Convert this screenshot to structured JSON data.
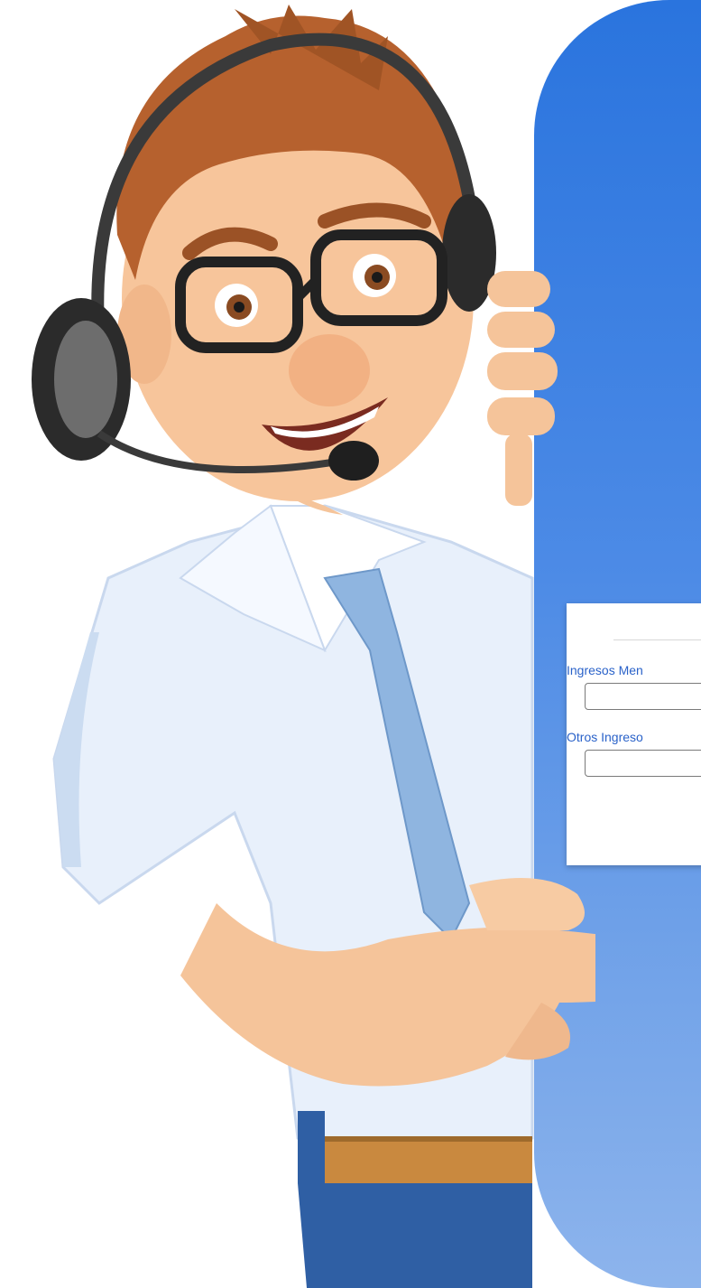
{
  "form": {
    "fields": [
      {
        "label": "Ingresos Men",
        "value": ""
      },
      {
        "label": "Otros Ingreso",
        "value": ""
      }
    ]
  },
  "illustration": {
    "subject": "customer-service-agent-pointing-icon",
    "panel_color": "#2a74de"
  }
}
